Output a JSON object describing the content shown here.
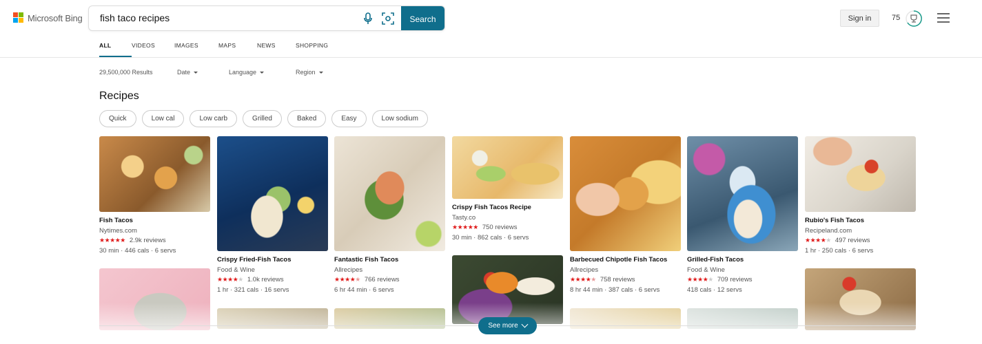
{
  "header": {
    "brand": "Microsoft Bing",
    "query": "fish taco recipes",
    "search_label": "Search",
    "signin_label": "Sign in",
    "points": "75"
  },
  "tabs": [
    {
      "label": "ALL",
      "active": true
    },
    {
      "label": "VIDEOS"
    },
    {
      "label": "IMAGES"
    },
    {
      "label": "MAPS"
    },
    {
      "label": "NEWS"
    },
    {
      "label": "SHOPPING"
    }
  ],
  "filters": {
    "results_count": "29,500,000 Results",
    "date": "Date",
    "language": "Language",
    "region": "Region"
  },
  "section_title": "Recipes",
  "chips": [
    "Quick",
    "Low cal",
    "Low carb",
    "Grilled",
    "Baked",
    "Easy",
    "Low sodium"
  ],
  "recipes": [
    {
      "title": "Fish Tacos",
      "source": "Nytimes.com",
      "stars": 5,
      "reviews": "2.9k reviews",
      "meta": "30 min · 446 cals · 6 servs"
    },
    {
      "title": "Crispy Fried-Fish Tacos",
      "source": "Food & Wine",
      "stars": 4,
      "reviews": "1.0k reviews",
      "meta": "1 hr · 321 cals · 16 servs"
    },
    {
      "title": "Fantastic Fish Tacos",
      "source": "Allrecipes",
      "stars": 4.5,
      "reviews": "766 reviews",
      "meta": "6 hr 44 min · 6 servs"
    },
    {
      "title": "Crispy Fish Tacos Recipe",
      "source": "Tasty.co",
      "stars": 5,
      "reviews": "750 reviews",
      "meta": "30 min · 862 cals · 6 servs"
    },
    {
      "title": "Barbecued Chipotle Fish Tacos",
      "source": "Allrecipes",
      "stars": 4.5,
      "reviews": "758 reviews",
      "meta": "8 hr 44 min · 387 cals · 6 servs"
    },
    {
      "title": "Grilled-Fish Tacos",
      "source": "Food & Wine",
      "stars": 4,
      "reviews": "709 reviews",
      "meta": "418 cals · 12 servs"
    },
    {
      "title": "Rubio's Fish Tacos",
      "source": "Recipeland.com",
      "stars": 4,
      "reviews": "497 reviews",
      "meta": "1 hr · 250 cals · 6 servs"
    }
  ],
  "see_more": "See more"
}
